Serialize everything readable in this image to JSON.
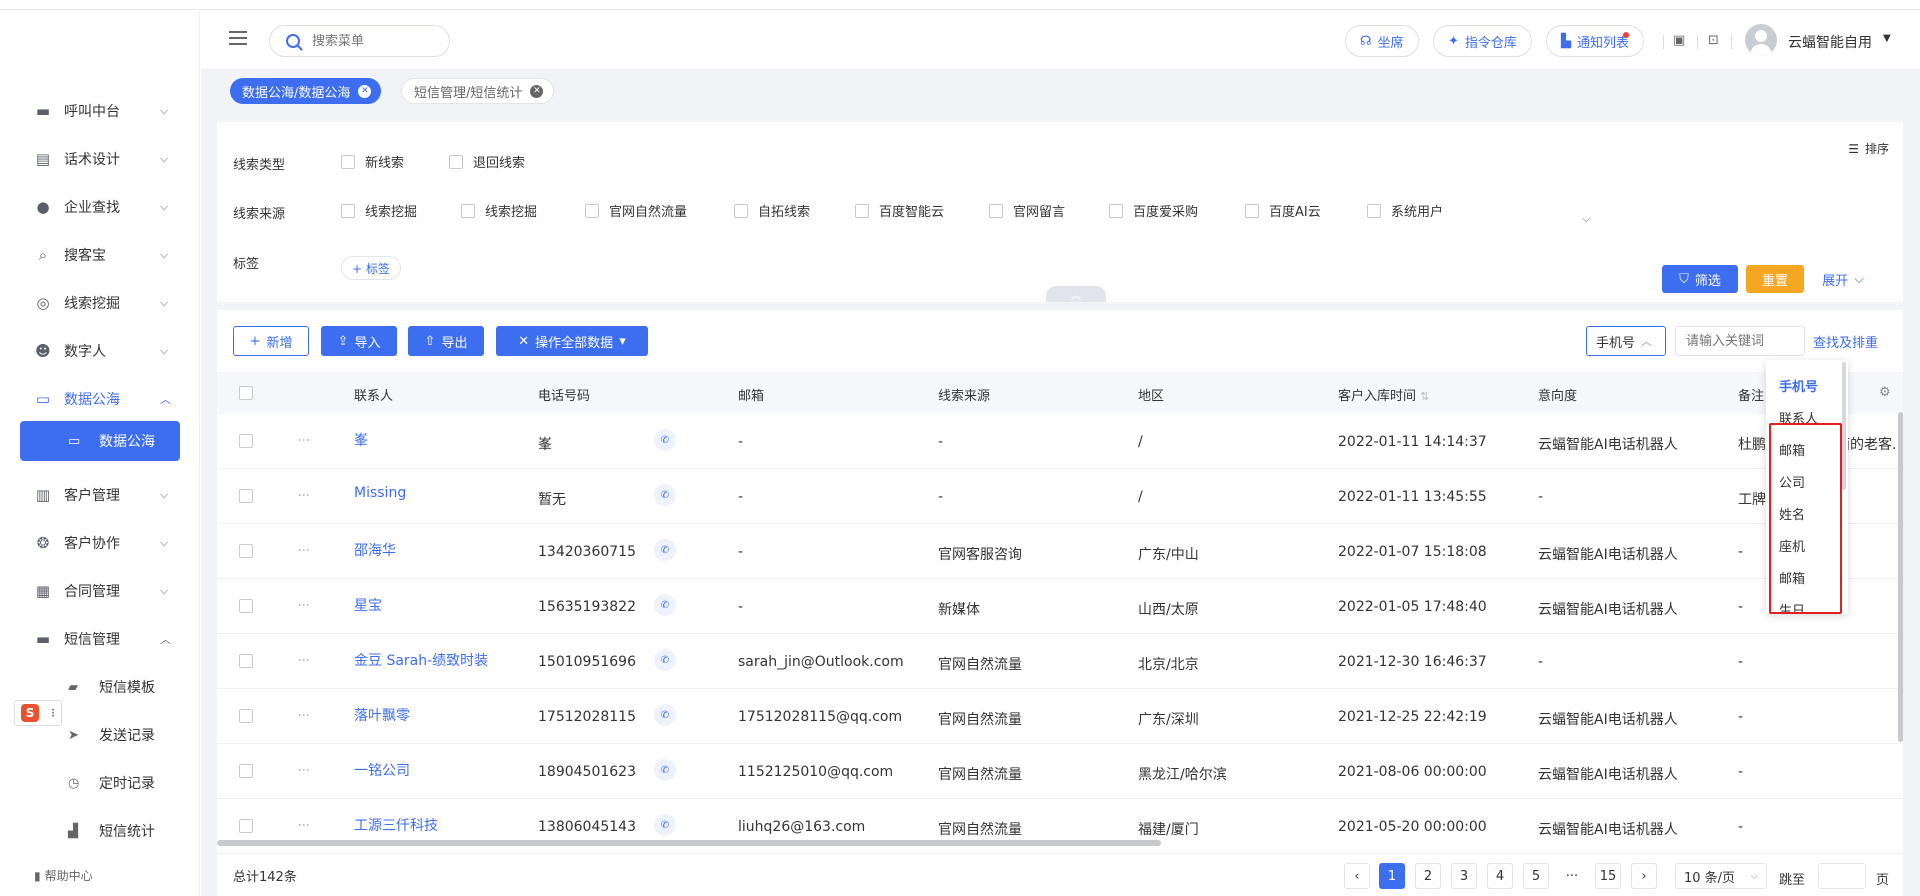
{
  "sidebar": {
    "items": [
      {
        "label": "呼叫中台",
        "icon": "monitor-icon"
      },
      {
        "label": "话术设计",
        "icon": "script-icon"
      },
      {
        "label": "企业查找",
        "icon": "bulb-icon"
      },
      {
        "label": "搜客宝",
        "icon": "search-icon"
      },
      {
        "label": "线索挖掘",
        "icon": "target-icon"
      },
      {
        "label": "数字人",
        "icon": "robot-icon"
      },
      {
        "label": "数据公海",
        "icon": "chart-icon"
      },
      {
        "label": "客户管理",
        "icon": "contacts-icon"
      },
      {
        "label": "客户协作",
        "icon": "team-icon"
      },
      {
        "label": "合同管理",
        "icon": "clipboard-icon"
      },
      {
        "label": "短信管理",
        "icon": "message-icon"
      }
    ],
    "sub_data": "数据公海",
    "sms_subs": [
      "短信模板",
      "发送记录",
      "定时记录",
      "短信统计"
    ],
    "help": "帮助中心"
  },
  "header": {
    "search_placeholder": "搜索菜单",
    "btn_seat": "坐席",
    "btn_cmd": "指令仓库",
    "btn_notice": "通知列表",
    "username": "云蝠智能自用"
  },
  "tabs": [
    "数据公海/数据公海",
    "短信管理/短信统计"
  ],
  "filter": {
    "type_label": "线索类型",
    "type_opts": [
      "新线索",
      "退回线索"
    ],
    "source_label": "线索来源",
    "source_opts": [
      "线索挖掘",
      "线索挖掘",
      "官网自然流量",
      "自拓线索",
      "百度智能云",
      "官网留言",
      "百度爱采购",
      "百度AI云",
      "系统用户"
    ],
    "tag_label": "标签",
    "tag_btn": "+ 标签",
    "sort": "排序",
    "btn_filter": "筛选",
    "btn_reset": "重置",
    "btn_expand": "展开"
  },
  "toolbar": {
    "add": "新增",
    "import": "导入",
    "export": "导出",
    "ops": "操作全部数据",
    "select_value": "手机号",
    "kw_placeholder": "请输入关键词",
    "find": "查找及排重"
  },
  "table": {
    "headers": [
      "联系人",
      "电话号码",
      "邮箱",
      "线索来源",
      "地区",
      "客户入库时间",
      "意向度",
      "备注"
    ],
    "rows": [
      {
        "name": "峯",
        "phone": "峯",
        "email": "-",
        "source": "-",
        "region": "/",
        "time": "2022-01-11 14:14:37",
        "intent": "云蝠智能AI电话机器人",
        "note": "杜鹏个人微信上面的老客..."
      },
      {
        "name": "Missing",
        "phone": "暂无",
        "email": "-",
        "source": "-",
        "region": "/",
        "time": "2022-01-11 13:45:55",
        "intent": "-",
        "note": "工牌"
      },
      {
        "name": "邵海华",
        "phone": "13420360715",
        "email": "-",
        "source": "官网客服咨询",
        "region": "广东/中山",
        "time": "2022-01-07 15:18:08",
        "intent": "云蝠智能AI电话机器人",
        "note": "-"
      },
      {
        "name": "星宝",
        "phone": "15635193822",
        "email": "-",
        "source": "新媒体",
        "region": "山西/太原",
        "time": "2022-01-05 17:48:40",
        "intent": "云蝠智能AI电话机器人",
        "note": "-"
      },
      {
        "name": "金豆 Sarah-绩致时装",
        "phone": "15010951696",
        "email": "sarah_jin@Outlook.com",
        "source": "官网自然流量",
        "region": "北京/北京",
        "time": "2021-12-30 16:46:37",
        "intent": "-",
        "note": "-"
      },
      {
        "name": "落叶飘零",
        "phone": "17512028115",
        "email": "17512028115@qq.com",
        "source": "官网自然流量",
        "region": "广东/深圳",
        "time": "2021-12-25 22:42:19",
        "intent": "云蝠智能AI电话机器人",
        "note": "-"
      },
      {
        "name": "一铭公司",
        "phone": "18904501623",
        "email": "1152125010@qq.com",
        "source": "官网自然流量",
        "region": "黑龙江/哈尔滨",
        "time": "2021-08-06 00:00:00",
        "intent": "云蝠智能AI电话机器人",
        "note": "-"
      },
      {
        "name": "工源三仟科技",
        "phone": "13806045143",
        "email": "liuhq26@163.com",
        "source": "官网自然流量",
        "region": "福建/厦门",
        "time": "2021-05-20 00:00:00",
        "intent": "云蝠智能AI电话机器人",
        "note": "-"
      }
    ]
  },
  "dropdown": [
    "手机号",
    "联系人",
    "邮箱",
    "公司",
    "姓名",
    "座机",
    "邮箱",
    "生日"
  ],
  "pagination": {
    "total": "总计142条",
    "pages": [
      "1",
      "2",
      "3",
      "4",
      "5",
      "···",
      "15"
    ],
    "per_page": "10 条/页",
    "jump": "跳至",
    "page_suffix": "页"
  },
  "colors": {
    "primary": "#3d6ef0",
    "reset": "#f5a623",
    "highlight": "#e02020"
  }
}
